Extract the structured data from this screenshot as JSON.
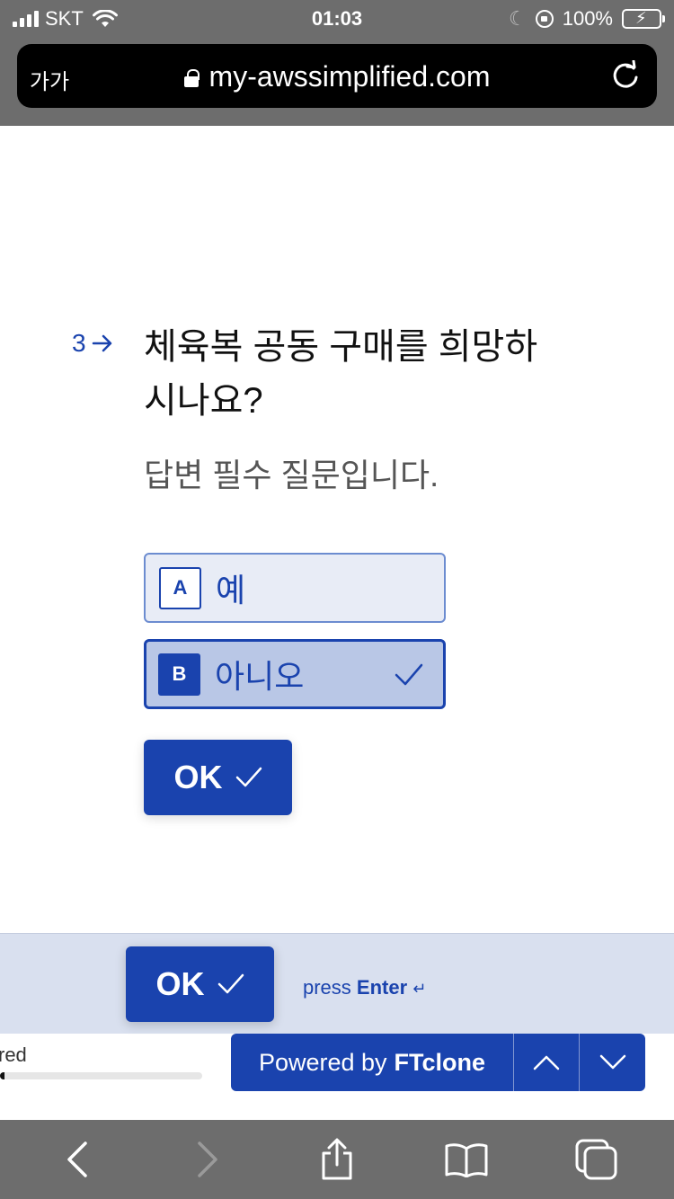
{
  "status_bar": {
    "carrier": "SKT",
    "time": "01:03",
    "battery": "100%"
  },
  "browser": {
    "text_size_button": "가가",
    "url": "my-awssimplified.com"
  },
  "question": {
    "number": "3",
    "text": "체육복 공동 구매를 희망하시나요?",
    "description": "답변 필수 질문입니다."
  },
  "choices": [
    {
      "key": "A",
      "label": "예",
      "selected": false
    },
    {
      "key": "B",
      "label": "아니오",
      "selected": true
    }
  ],
  "ok_button": {
    "label": "OK"
  },
  "bottom_bar": {
    "ok_label": "OK",
    "press_text": "press",
    "enter_text": "Enter",
    "enter_symbol": "↵",
    "progress_label": "red",
    "progress_fraction": 0.02,
    "powered_prefix": "Powered by",
    "powered_brand": "FTclone"
  },
  "colors": {
    "accent": "#1a43ae",
    "selected_choice_bg": "#b9c7e6",
    "choice_bg": "#e8ecf6",
    "chrome_gray": "#6d6d6d"
  },
  "icons": {
    "back": "chevron-left-icon",
    "forward": "chevron-right-icon",
    "share": "share-icon",
    "bookmarks": "book-icon",
    "tabs": "tabs-icon",
    "reload": "reload-icon"
  }
}
